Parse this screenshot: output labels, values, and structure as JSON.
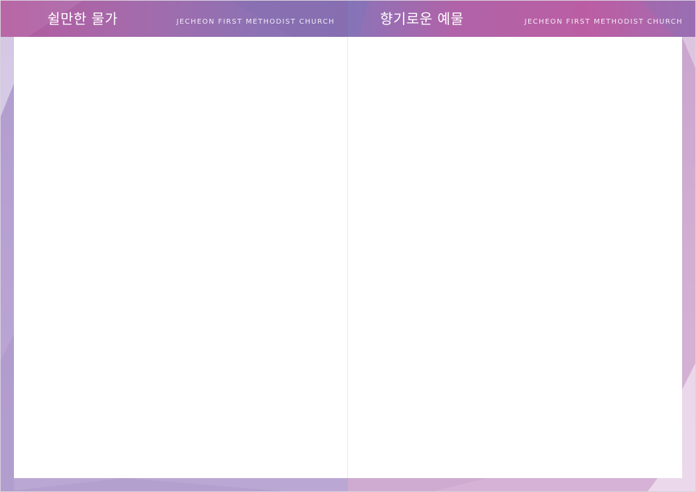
{
  "spread": {
    "left_page": {
      "title": "쉴만한 물가",
      "subtitle": "JECHEON  FIRST  METHODIST  CHURCH"
    },
    "right_page": {
      "title": "향기로운 예물",
      "subtitle": "JECHEON  FIRST  METHODIST  CHURCH"
    }
  },
  "colors": {
    "left_header": "#a46bac",
    "right_header": "#bb5ea4",
    "left_border": "#b8a3d3",
    "right_border": "#d3afd3",
    "content_bg": "#ffffff"
  }
}
